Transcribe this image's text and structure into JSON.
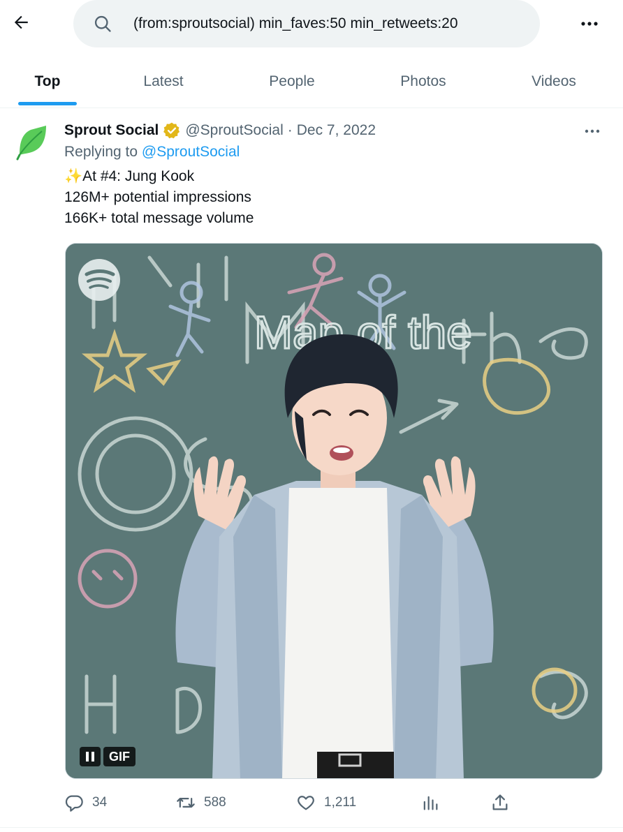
{
  "header": {
    "search": {
      "value": "(from:sproutsocial) min_faves:50 min_retweets:20",
      "placeholder": "Search"
    }
  },
  "tabs": [
    {
      "label": "Top",
      "active": true
    },
    {
      "label": "Latest",
      "active": false
    },
    {
      "label": "People",
      "active": false
    },
    {
      "label": "Photos",
      "active": false
    },
    {
      "label": "Videos",
      "active": false
    }
  ],
  "tweet": {
    "display_name": "Sprout Social",
    "handle": "@SproutSocial",
    "separator": "·",
    "date": "Dec 7, 2022",
    "reply_prefix": "Replying to",
    "reply_handle": "@SproutSocial",
    "lines": [
      "✨At #4: Jung Kook",
      "126M+ potential impressions",
      "166K+ total message volume"
    ],
    "media": {
      "gif_label": "GIF",
      "chalk_title": "Map of the",
      "icon": "spotify-icon"
    },
    "stats": {
      "replies": "34",
      "retweets": "588",
      "likes": "1,211"
    }
  },
  "colors": {
    "accent": "#1d9bf0",
    "verified_gold": "#e2b719",
    "brand_green": "#59cb59",
    "secondary_text": "#536471"
  },
  "icons": [
    "back-arrow-icon",
    "search-icon",
    "more-icon",
    "verified-badge-icon",
    "reply-icon",
    "retweet-icon",
    "like-icon",
    "analytics-icon",
    "share-icon",
    "pause-icon"
  ]
}
